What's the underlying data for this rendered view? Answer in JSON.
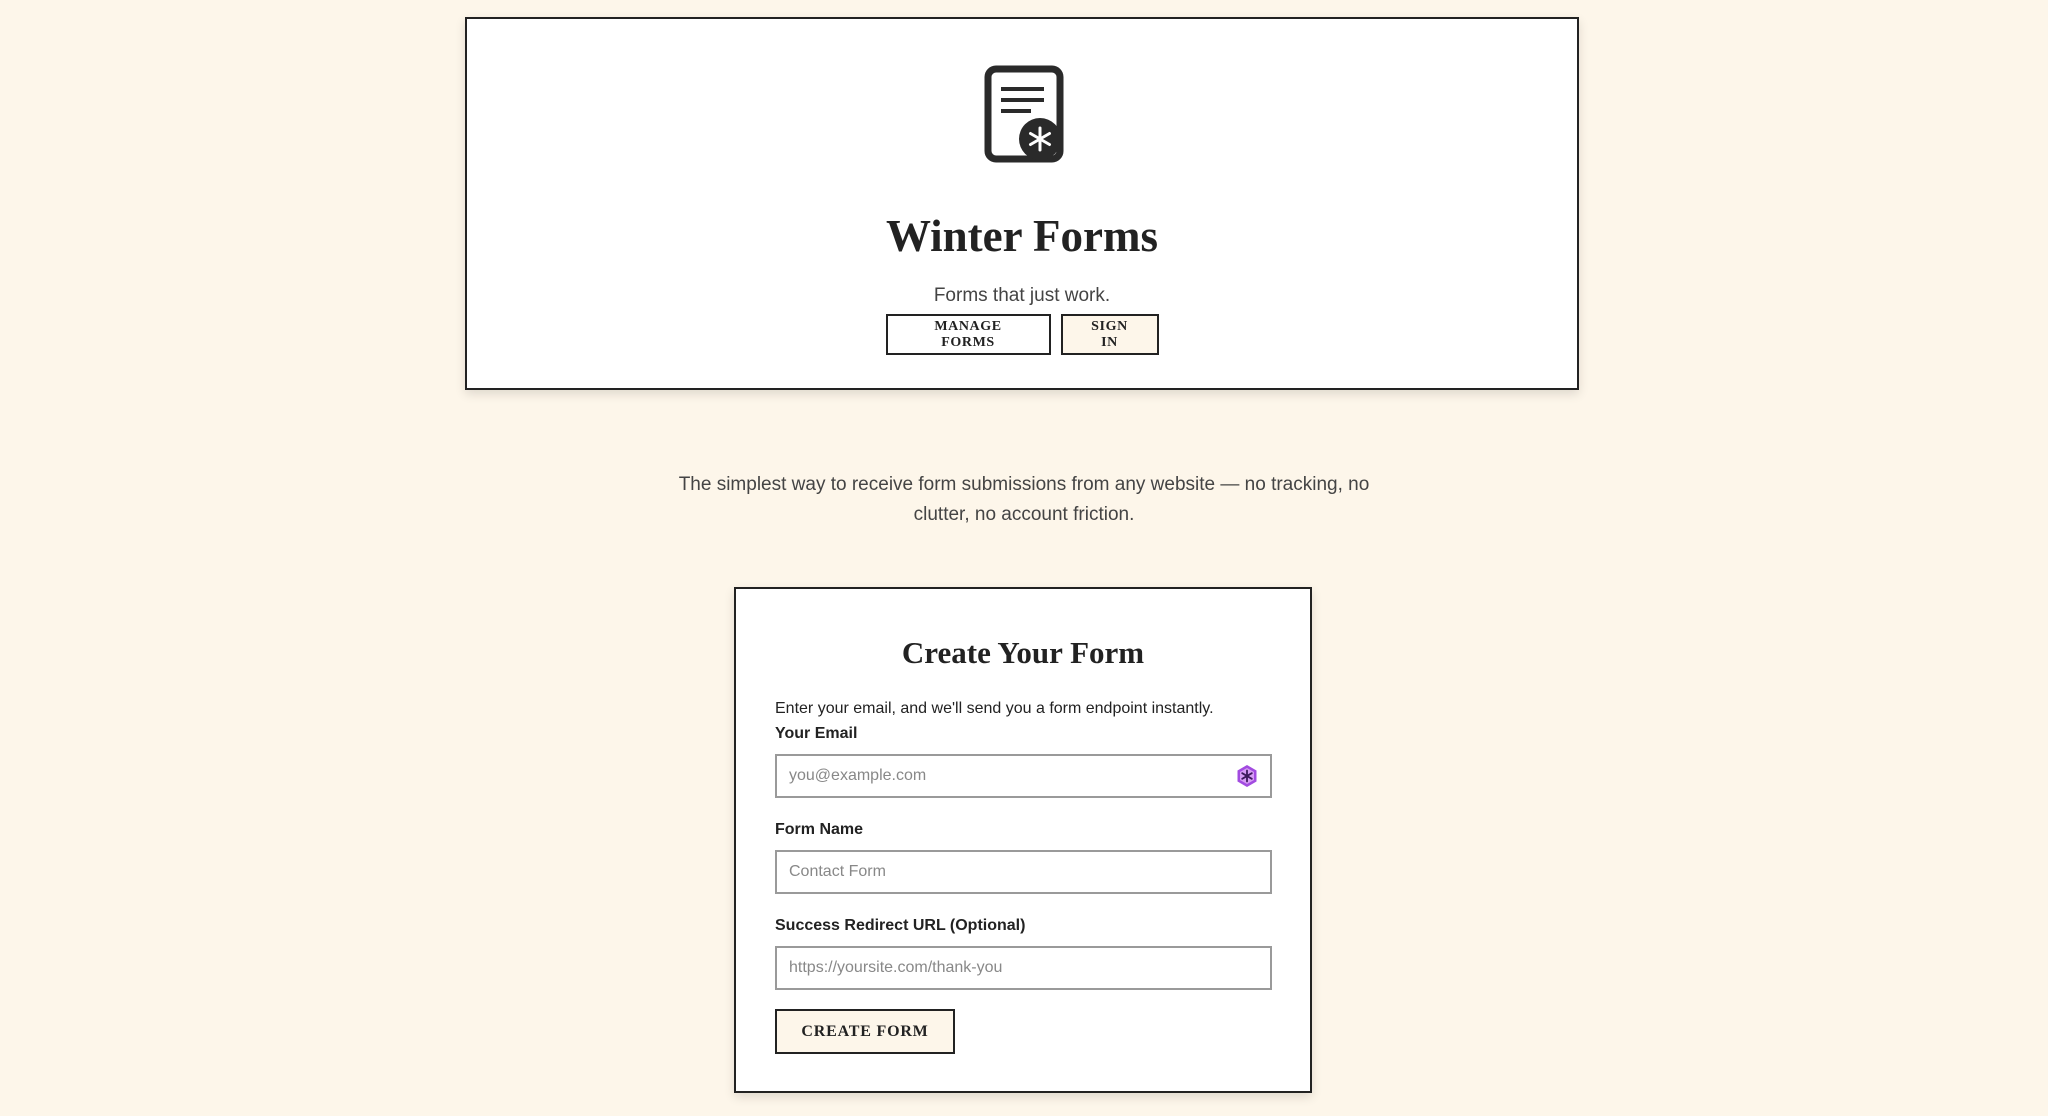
{
  "hero": {
    "logo_icon": "document-snowflake-icon",
    "title": "Winter Forms",
    "tagline": "Forms that just work.",
    "manage_forms_label": "MANAGE FORMS",
    "sign_in_label": "SIGN IN"
  },
  "intro": {
    "text": "The simplest way to receive form submissions from any website — no tracking, no clutter, no account friction."
  },
  "create_form": {
    "title": "Create Your Form",
    "description": "Enter your email, and we'll send you a form endpoint instantly.",
    "email": {
      "label": "Your Email",
      "value": "",
      "placeholder": "you@example.com",
      "extension_icon": "password-manager-extension-icon"
    },
    "form_name": {
      "label": "Form Name",
      "value": "",
      "placeholder": "Contact Form"
    },
    "redirect_url": {
      "label": "Success Redirect URL (Optional)",
      "value": "",
      "placeholder": "https://yoursite.com/thank-you"
    },
    "submit_label": "CREATE FORM"
  },
  "colors": {
    "page_background": "#fdf6ea",
    "card_background": "#ffffff",
    "border": "#222222",
    "input_border": "#9a9a9a",
    "extension_icon_accent": "#a24be0"
  }
}
